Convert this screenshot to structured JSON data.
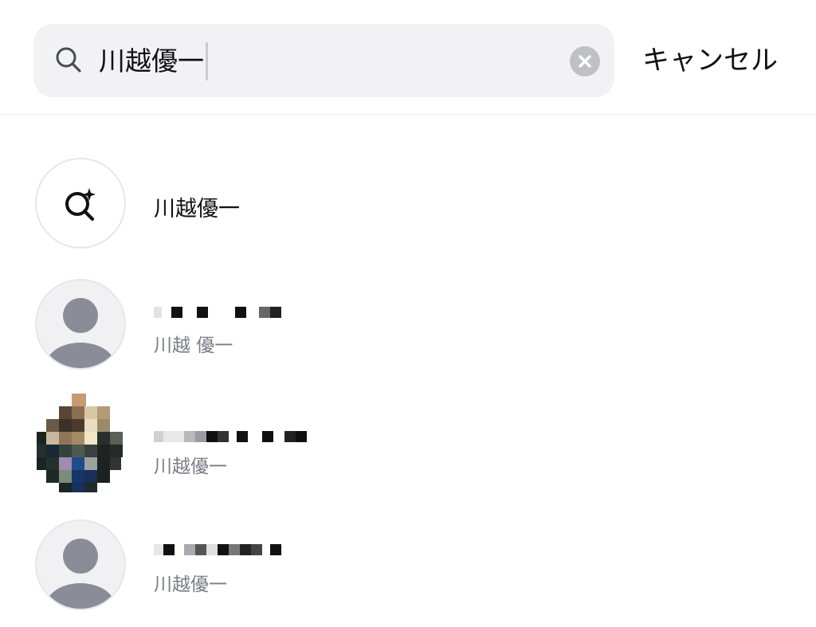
{
  "search": {
    "query": "川越優一",
    "cancel_label": "キャンセル"
  },
  "results": {
    "suggestion": {
      "label": "川越優一"
    },
    "contacts": [
      {
        "display_name": "",
        "subtitle": "川越 優一"
      },
      {
        "display_name": "",
        "subtitle": "川越優一"
      },
      {
        "display_name": "",
        "subtitle": "川越優一"
      }
    ]
  },
  "colors": {
    "search_bg": "#f2f2f5",
    "clear_button": "#bfc0c5",
    "secondary_text": "#7b7d86",
    "default_avatar": "#8a8d98"
  },
  "icons": {
    "search": "search-icon",
    "clear": "clear-icon",
    "suggestion": "search-sparkle-icon",
    "avatar": "person-icon"
  }
}
